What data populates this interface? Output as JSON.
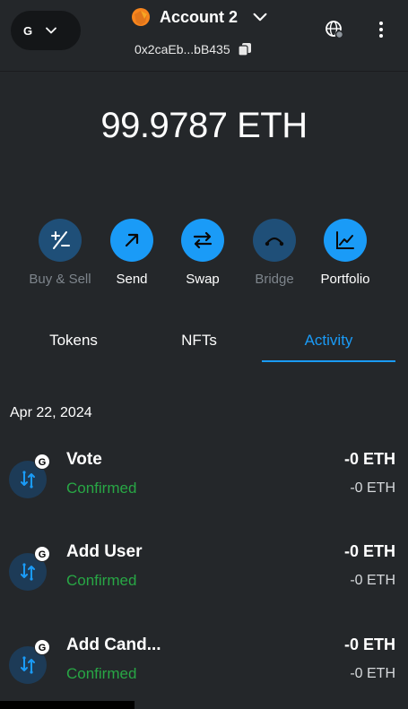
{
  "header": {
    "network_badge": "G",
    "account_name": "Account 2",
    "address": "0x2caEb...bB435"
  },
  "balance": "99.9787 ETH",
  "actions": [
    {
      "label": "Buy & Sell",
      "icon": "plus-minus-icon",
      "state": "disabled"
    },
    {
      "label": "Send",
      "icon": "arrow-up-right-icon",
      "state": "enabled"
    },
    {
      "label": "Swap",
      "icon": "swap-arrows-icon",
      "state": "enabled"
    },
    {
      "label": "Bridge",
      "icon": "bridge-icon",
      "state": "disabled"
    },
    {
      "label": "Portfolio",
      "icon": "chart-icon",
      "state": "enabled"
    }
  ],
  "tabs": [
    {
      "label": "Tokens",
      "active": false
    },
    {
      "label": "NFTs",
      "active": false
    },
    {
      "label": "Activity",
      "active": true
    }
  ],
  "activity": {
    "date": "Apr 22, 2024",
    "items": [
      {
        "title": "Vote",
        "status": "Confirmed",
        "amount": "-0 ETH",
        "amount_sub": "-0 ETH",
        "badge": "G"
      },
      {
        "title": "Add User",
        "status": "Confirmed",
        "amount": "-0 ETH",
        "amount_sub": "-0 ETH",
        "badge": "G"
      },
      {
        "title": "Add Cand...",
        "status": "Confirmed",
        "amount": "-0 ETH",
        "amount_sub": "-0 ETH",
        "badge": "G"
      }
    ]
  },
  "colors": {
    "background": "#24272a",
    "accent": "#1a9bf7",
    "disabled_action": "#1f4f78",
    "confirmed": "#28a745"
  }
}
